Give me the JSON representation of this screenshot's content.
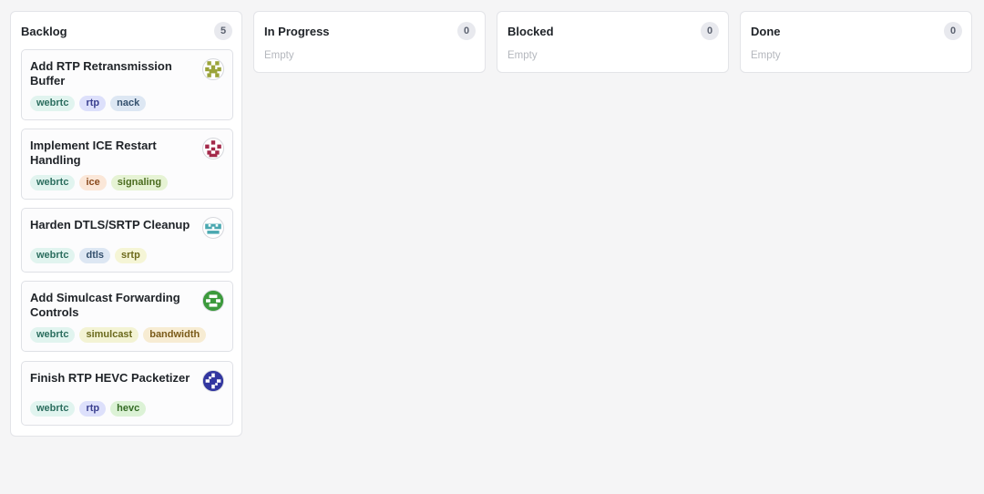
{
  "columns": [
    {
      "title": "Backlog",
      "count": "5",
      "cards": [
        {
          "title": "Add RTP Retransmission Buffer",
          "avatar": "identicon-olive",
          "tags": [
            {
              "label": "webrtc",
              "color": "#e1f4ef",
              "text": "#2c6e5f"
            },
            {
              "label": "rtp",
              "color": "#dde0fb",
              "text": "#3a3f8f"
            },
            {
              "label": "nack",
              "color": "#dde7f3",
              "text": "#34506d"
            }
          ]
        },
        {
          "title": "Implement ICE Restart Handling",
          "avatar": "identicon-crimson",
          "tags": [
            {
              "label": "webrtc",
              "color": "#e1f4ef",
              "text": "#2c6e5f"
            },
            {
              "label": "ice",
              "color": "#fbe7d8",
              "text": "#8a4a1d"
            },
            {
              "label": "signaling",
              "color": "#e6f3d4",
              "text": "#4a6b1e"
            }
          ]
        },
        {
          "title": "Harden DTLS/SRTP Cleanup",
          "avatar": "identicon-teal",
          "tags": [
            {
              "label": "webrtc",
              "color": "#e1f4ef",
              "text": "#2c6e5f"
            },
            {
              "label": "dtls",
              "color": "#dde7f3",
              "text": "#34506d"
            },
            {
              "label": "srtp",
              "color": "#f5f5d6",
              "text": "#6d6a1c"
            }
          ]
        },
        {
          "title": "Add Simulcast Forwarding Controls",
          "avatar": "identicon-green",
          "tags": [
            {
              "label": "webrtc",
              "color": "#e1f4ef",
              "text": "#2c6e5f"
            },
            {
              "label": "simulcast",
              "color": "#f3f3d4",
              "text": "#6b6a1d"
            },
            {
              "label": "bandwidth",
              "color": "#f7ecd3",
              "text": "#7a5a19"
            }
          ]
        },
        {
          "title": "Finish RTP HEVC Packetizer",
          "avatar": "identicon-indigo",
          "tags": [
            {
              "label": "webrtc",
              "color": "#e1f4ef",
              "text": "#2c6e5f"
            },
            {
              "label": "rtp",
              "color": "#dde0fb",
              "text": "#3a3f8f"
            },
            {
              "label": "hevc",
              "color": "#dcf2d6",
              "text": "#346b25"
            }
          ]
        }
      ]
    },
    {
      "title": "In Progress",
      "count": "0",
      "empty_label": "Empty",
      "cards": []
    },
    {
      "title": "Blocked",
      "count": "0",
      "empty_label": "Empty",
      "cards": []
    },
    {
      "title": "Done",
      "count": "0",
      "empty_label": "Empty",
      "cards": []
    }
  ],
  "avatar_colors": [
    "#9aa33a",
    "#a3294a",
    "#4aa8b0",
    "#3c9a3c",
    "#3236a0"
  ]
}
